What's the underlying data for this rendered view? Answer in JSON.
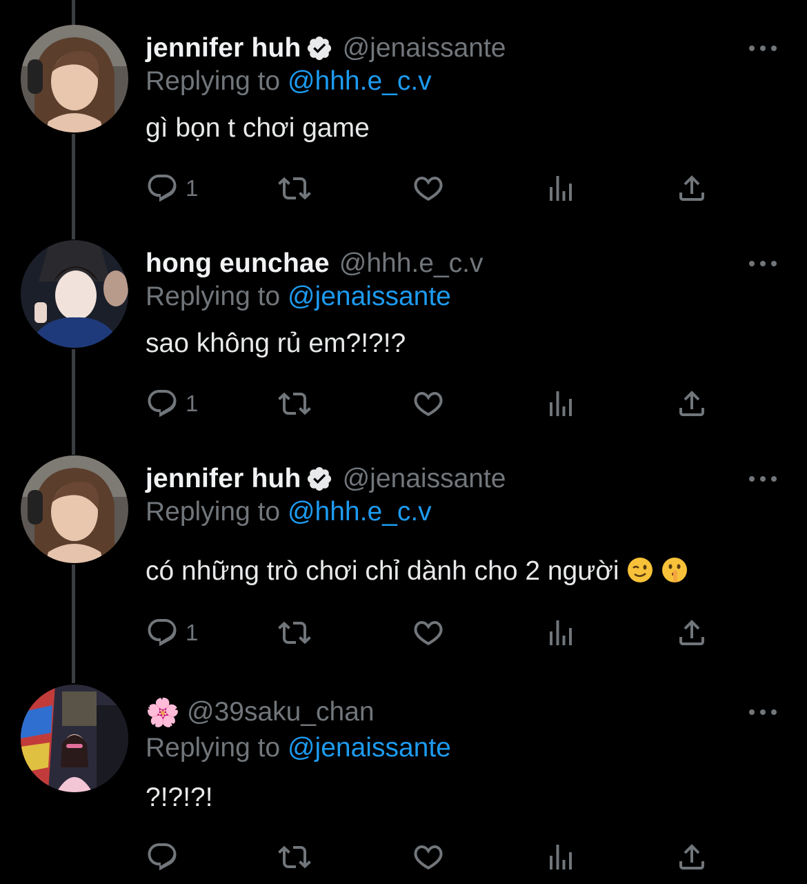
{
  "tweets": [
    {
      "name": "jennifer huh",
      "verified": true,
      "handle": "@jenaissante",
      "replying_label": "Replying to ",
      "replying_to": "@hhh.e_c.v",
      "text": "gì bọn t chơi game",
      "reply_count": "1"
    },
    {
      "name": "hong eunchae",
      "verified": false,
      "handle": "@hhh.e_c.v",
      "replying_label": "Replying to ",
      "replying_to": "@jenaissante",
      "text": "sao không rủ em?!?!?",
      "reply_count": "1"
    },
    {
      "name": "jennifer huh",
      "verified": true,
      "handle": "@jenaissante",
      "replying_label": "Replying to ",
      "replying_to": "@hhh.e_c.v",
      "text": "có những trò chơi chỉ dành cho 2 người",
      "emojis": [
        "winking-face",
        "shushing-face"
      ],
      "reply_count": "1"
    },
    {
      "name": "🌸",
      "verified": false,
      "handle": "@39saku_chan",
      "replying_label": "Replying to ",
      "replying_to": "@jenaissante",
      "text": "?!?!?!",
      "reply_count": ""
    }
  ],
  "colors": {
    "background": "#000000",
    "text": "#e7e9ea",
    "secondary": "#71767b",
    "link": "#1d9bf0",
    "thread_line": "#3a3d41"
  },
  "icons": [
    "reply-icon",
    "retweet-icon",
    "like-icon",
    "views-icon",
    "share-icon",
    "more-icon",
    "verified-badge-icon"
  ]
}
